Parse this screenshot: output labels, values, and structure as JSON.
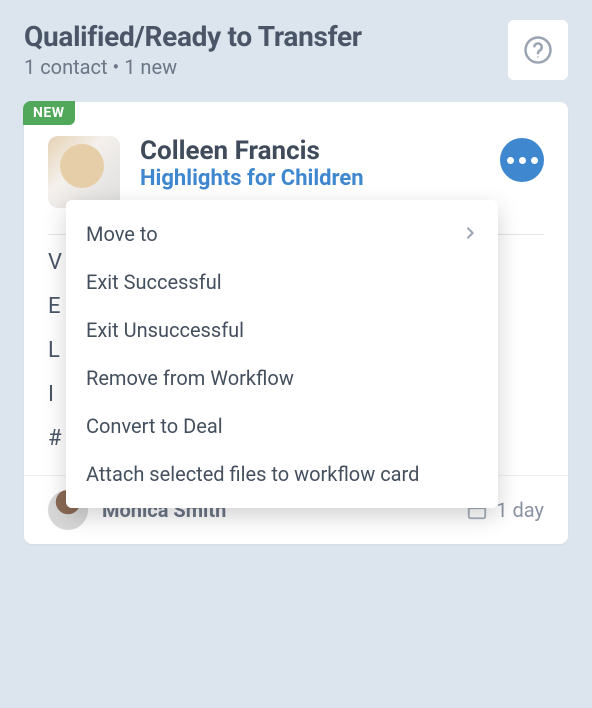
{
  "header": {
    "title": "Qualified/Ready to Transfer",
    "subtitle": "1 contact • 1 new"
  },
  "card": {
    "badge": "NEW",
    "contact_name": "Colleen Francis",
    "company": "Highlights for Children",
    "owner": "Monica Smith",
    "duration": "1 day",
    "detail_lines": [
      "V",
      "E",
      "L",
      "I",
      "#"
    ]
  },
  "menu": {
    "items": [
      {
        "label": "Move to",
        "has_submenu": true
      },
      {
        "label": "Exit Successful",
        "has_submenu": false
      },
      {
        "label": "Exit Unsuccessful",
        "has_submenu": false
      },
      {
        "label": "Remove from Workflow",
        "has_submenu": false
      },
      {
        "label": "Convert to Deal",
        "has_submenu": false
      },
      {
        "label": "Attach selected files to workflow card",
        "has_submenu": false
      }
    ]
  }
}
